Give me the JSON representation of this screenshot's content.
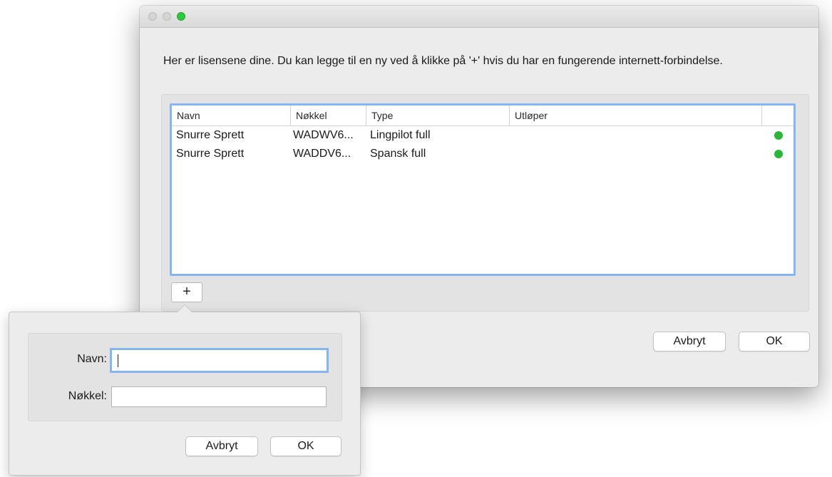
{
  "dialog": {
    "description": "Her er lisensene dine. Du kan legge til en ny ved å klikke på  '+'  hvis du har en fungerende internett-forbindelse.",
    "columns": [
      "Navn",
      "Nøkkel",
      "Type",
      "Utløper"
    ],
    "licenses": [
      {
        "name": "Snurre Sprett",
        "key": "WADWV6...",
        "type": "Lingpilot full",
        "expires": "",
        "status": "active"
      },
      {
        "name": "Snurre Sprett",
        "key": "WADDV6...",
        "type": "Spansk full",
        "expires": "",
        "status": "active"
      }
    ],
    "add_label": "+",
    "cancel_label": "Avbryt",
    "ok_label": "OK",
    "colors": {
      "selection_border": "#86b5f1",
      "status_active": "#2bb63a",
      "zoom_button": "#2ec83f"
    }
  },
  "popover": {
    "name_label": "Navn:",
    "name_value": "",
    "key_label": "Nøkkel:",
    "key_value": "",
    "cancel_label": "Avbryt",
    "ok_label": "OK"
  }
}
